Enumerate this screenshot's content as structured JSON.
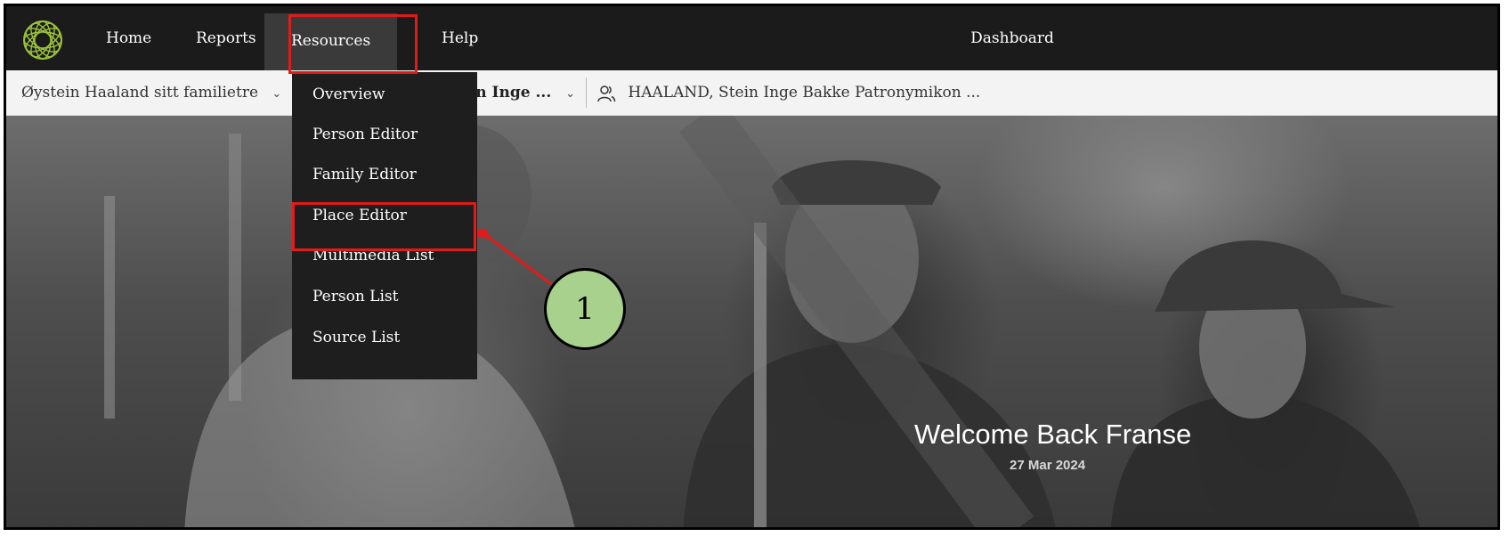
{
  "nav": {
    "home": "Home",
    "reports": "Reports",
    "resources": "Resources",
    "help": "Help",
    "dashboard": "Dashboard"
  },
  "subbar": {
    "tree": "Øystein Haaland sitt familietre",
    "person": "ein Inge ...",
    "active_person": "HAALAND, Stein Inge Bakke Patronymikon ..."
  },
  "resources_menu": {
    "items": [
      {
        "label": "Overview"
      },
      {
        "label": "Person Editor"
      },
      {
        "label": "Family Editor"
      },
      {
        "label": "Place Editor"
      },
      {
        "label": "Multimedia List"
      },
      {
        "label": "Person List"
      },
      {
        "label": "Source List"
      }
    ]
  },
  "hero": {
    "welcome": "Welcome Back Franse",
    "date": "27 Mar 2024"
  },
  "annotation": {
    "step_number": "1",
    "color": "#e01b1b",
    "badge_color": "#a9d18e"
  },
  "icons": {
    "logo": "logo-icon",
    "chevron": "chevron-down-icon",
    "person": "person-group-icon"
  }
}
